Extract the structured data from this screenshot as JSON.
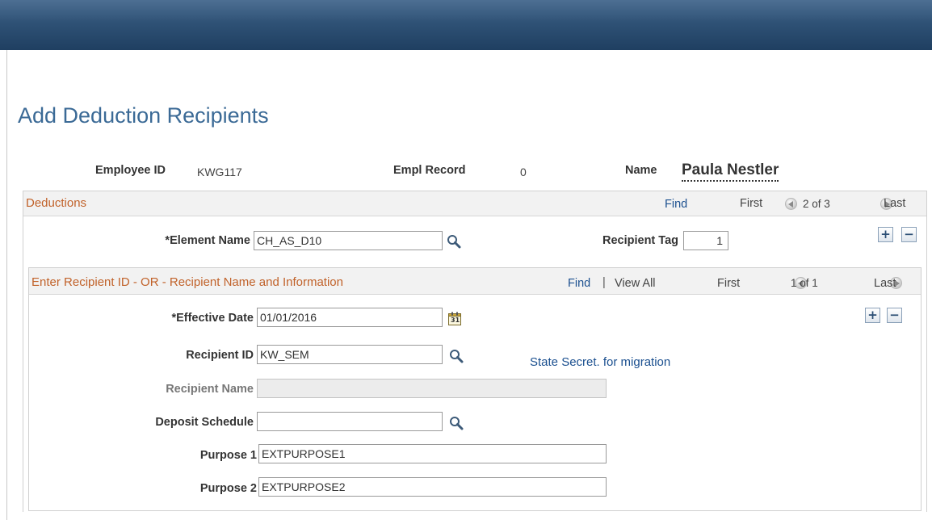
{
  "page": {
    "title": "Add Deduction Recipients"
  },
  "employee": {
    "id_label": "Employee ID",
    "id_value": "KWG117",
    "record_label": "Empl Record",
    "record_value": "0",
    "name_label": "Name",
    "name_value": "Paula Nestler"
  },
  "deductions": {
    "header": "Deductions",
    "find": "Find",
    "first": "First",
    "count": "2 of 3",
    "last": "Last",
    "element_name_label": "*Element Name",
    "element_name_value": "CH_AS_D10",
    "recipient_tag_label": "Recipient Tag",
    "recipient_tag_value": "1",
    "add_row": "+",
    "delete_row": "−"
  },
  "recipient": {
    "header": "Enter Recipient ID - OR - Recipient Name and Information",
    "find": "Find",
    "separator": "|",
    "view_all": "View All",
    "first": "First",
    "count": "1 of 1",
    "last": "Last",
    "add_row": "+",
    "delete_row": "−",
    "effective_date_label": "*Effective Date",
    "effective_date_value": "01/01/2016",
    "calendar_day": "31",
    "recipient_id_label": "Recipient ID",
    "recipient_id_value": "KW_SEM",
    "recipient_id_desc": "State Secret. for migration",
    "recipient_name_label": "Recipient Name",
    "recipient_name_value": "",
    "deposit_schedule_label": "Deposit Schedule",
    "deposit_schedule_value": "",
    "purpose1_label": "Purpose 1",
    "purpose1_value": "EXTPURPOSE1",
    "purpose2_label": "Purpose 2",
    "purpose2_value": "EXTPURPOSE2"
  },
  "icons": {
    "lookup": "magnifying-glass",
    "calendar": "calendar",
    "prev": "left-arrow-circle",
    "next": "right-arrow-circle"
  },
  "colors": {
    "header_bar": "#2f5276",
    "title": "#3b6a96",
    "section_header": "#c1622a",
    "link": "#1a4f8f"
  }
}
